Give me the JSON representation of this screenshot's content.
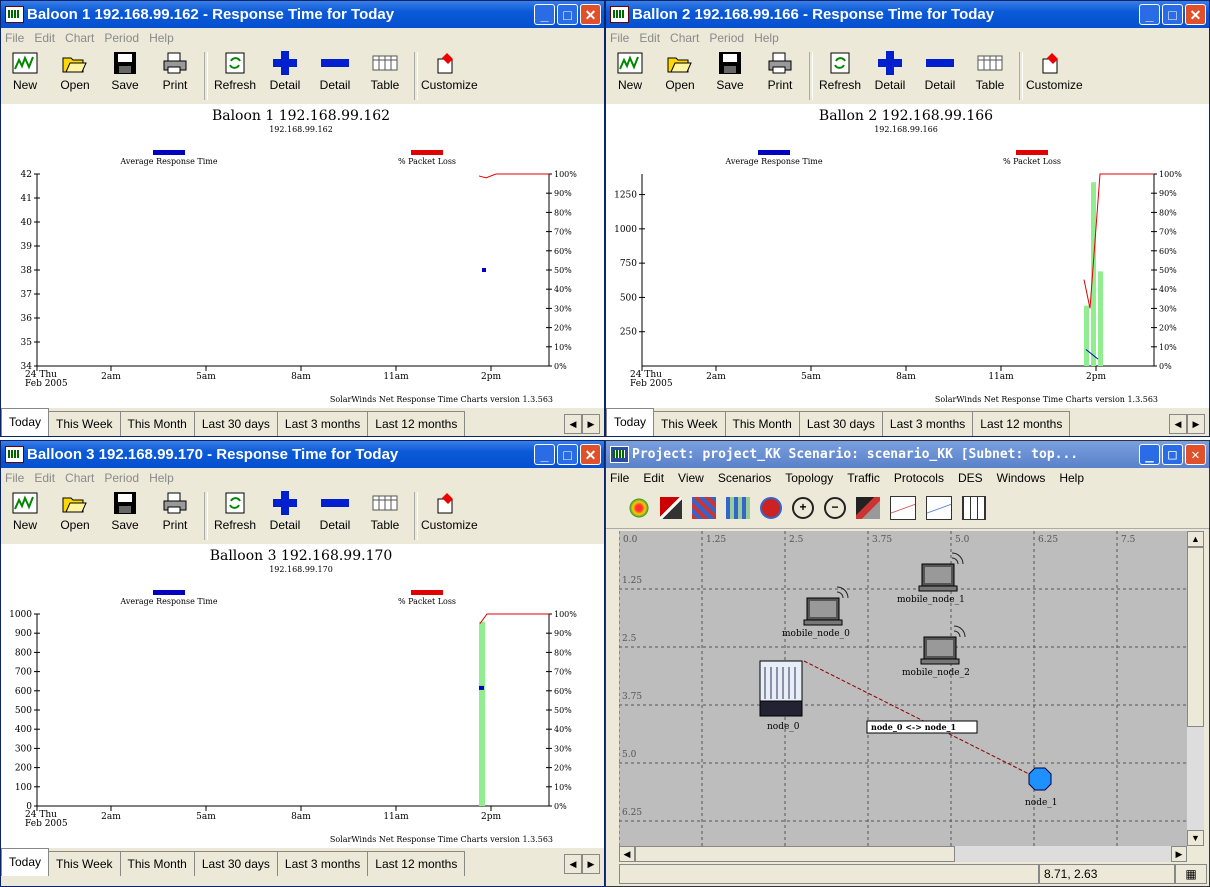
{
  "windows": [
    {
      "title": "Baloon 1 192.168.99.162 - Response Time for Today",
      "chart_title": "Baloon 1 192.168.99.162",
      "chart_subtitle": "192.168.99.162",
      "legend_left": "Average Response Time",
      "legend_right": "% Packet Loss",
      "footer": "SolarWinds Net Response Time Charts version 1.3.563",
      "date_label_1": "24 Thu",
      "date_label_2": "Feb 2005"
    },
    {
      "title": "Ballon 2 192.168.99.166 - Response Time for Today",
      "chart_title": "Ballon 2 192.168.99.166",
      "chart_subtitle": "192.168.99.166",
      "legend_left": "Average Response Time",
      "legend_right": "% Packet Loss",
      "footer": "SolarWinds Net Response Time Charts version 1.3.563",
      "date_label_1": "24 Thu",
      "date_label_2": "Feb 2005"
    },
    {
      "title": "Balloon 3 192.168.99.170 - Response Time for Today",
      "chart_title": "Balloon 3 192.168.99.170",
      "chart_subtitle": "192.168.99.170",
      "legend_left": "Average Response Time",
      "legend_right": "% Packet Loss",
      "footer": "SolarWinds Net Response Time Charts version 1.3.563",
      "date_label_1": "24 Thu",
      "date_label_2": "Feb 2005"
    }
  ],
  "menu": [
    "File",
    "Edit",
    "Chart",
    "Period",
    "Help"
  ],
  "toolbar": {
    "new": "New",
    "open": "Open",
    "save": "Save",
    "print": "Print",
    "refresh": "Refresh",
    "detail_plus": "Detail",
    "detail_minus": "Detail",
    "table": "Table",
    "customize": "Customize"
  },
  "tabs": [
    "Today",
    "This Week",
    "This Month",
    "Last 30 days",
    "Last 3 months",
    "Last 12 months"
  ],
  "opnet": {
    "title": "Project: project_KK Scenario: scenario_KK [Subnet: top...",
    "menu": [
      "File",
      "Edit",
      "View",
      "Scenarios",
      "Topology",
      "Traffic",
      "Protocols",
      "DES",
      "Windows",
      "Help"
    ],
    "x_ruler": [
      "0.0",
      "1.25",
      "2.5",
      "3.75",
      "5.0",
      "6.25",
      "7.5"
    ],
    "y_ruler": [
      "1.25",
      "2.5",
      "3.75",
      "5.0",
      "6.25"
    ],
    "nodes": {
      "mobile_node_0": "mobile_node_0",
      "mobile_node_1": "mobile_node_1",
      "mobile_node_2": "mobile_node_2",
      "node_0": "node_0",
      "node_1": "node_1"
    },
    "link_label": "node_0 <-> node_1",
    "coords": "8.71, 2.63"
  },
  "chart_data": [
    {
      "type": "line",
      "title": "Baloon 1 192.168.99.162",
      "subtitle": "192.168.99.162",
      "x_ticks": [
        "24 Thu Feb 2005",
        "2am",
        "5am",
        "8am",
        "11am",
        "2pm"
      ],
      "y_left_ticks": [
        34,
        35,
        36,
        37,
        38,
        39,
        40,
        41,
        42
      ],
      "y_right_ticks": [
        "0%",
        "10%",
        "20%",
        "30%",
        "40%",
        "50%",
        "60%",
        "70%",
        "80%",
        "90%",
        "100%"
      ],
      "series": [
        {
          "name": "Average Response Time",
          "color": "#0000c0",
          "points": [
            {
              "x": "~1:45pm",
              "y": 38
            }
          ]
        },
        {
          "name": "% Packet Loss",
          "color": "#e00000",
          "points": [
            {
              "x": "~1:45pm",
              "y": 99
            },
            {
              "x": "~2pm",
              "y": 100
            },
            {
              "x": "~5pm",
              "y": 100
            }
          ]
        }
      ]
    },
    {
      "type": "bar",
      "title": "Ballon 2 192.168.99.166",
      "subtitle": "192.168.99.166",
      "x_ticks": [
        "24 Thu Feb 2005",
        "2am",
        "5am",
        "8am",
        "11am",
        "2pm"
      ],
      "y_left_ticks": [
        250,
        500,
        750,
        1000,
        1250
      ],
      "y_right_ticks": [
        "0%",
        "10%",
        "20%",
        "30%",
        "40%",
        "50%",
        "60%",
        "70%",
        "80%",
        "90%",
        "100%"
      ],
      "series": [
        {
          "name": "bars",
          "color": "#90ee90",
          "values": [
            440,
            1340,
            690
          ]
        },
        {
          "name": "Average Response Time",
          "color": "#0000c0",
          "values": [
            120,
            50
          ]
        },
        {
          "name": "% Packet Loss",
          "color": "#e00000",
          "values": [
            45,
            30,
            100,
            100
          ]
        }
      ]
    },
    {
      "type": "bar",
      "title": "Balloon 3 192.168.99.170",
      "subtitle": "192.168.99.170",
      "x_ticks": [
        "24 Thu Feb 2005",
        "2am",
        "5am",
        "8am",
        "11am",
        "2pm"
      ],
      "y_left_ticks": [
        0,
        100,
        200,
        300,
        400,
        500,
        600,
        700,
        800,
        900,
        1000
      ],
      "y_right_ticks": [
        "0%",
        "10%",
        "20%",
        "30%",
        "40%",
        "50%",
        "60%",
        "70%",
        "80%",
        "90%",
        "100%"
      ],
      "series": [
        {
          "name": "bars",
          "color": "#90ee90",
          "values": [
            960
          ]
        },
        {
          "name": "Average Response Time",
          "color": "#0000c0",
          "values": [
            615
          ]
        },
        {
          "name": "% Packet Loss",
          "color": "#e00000",
          "values": [
            95,
            100,
            100
          ]
        }
      ]
    }
  ]
}
